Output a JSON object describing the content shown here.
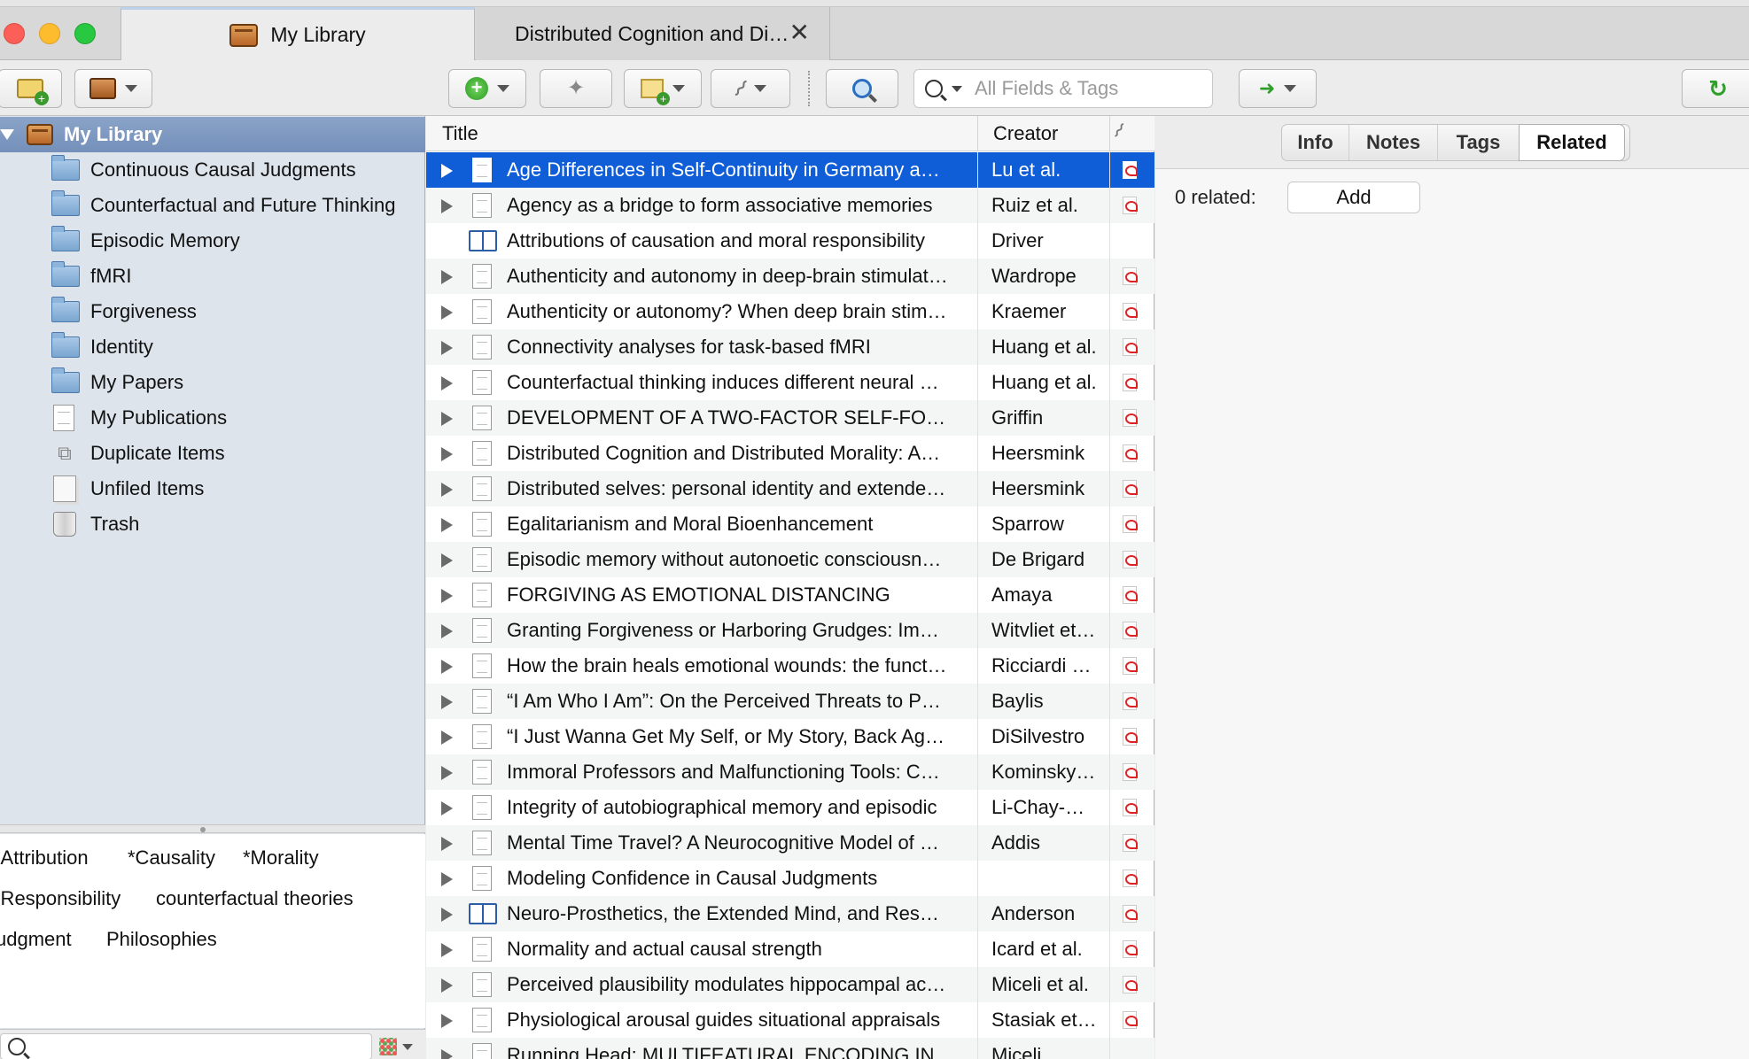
{
  "tabs": {
    "library": "My Library",
    "document": "Distributed Cognition and Distributed Morality"
  },
  "search": {
    "placeholder": "All Fields & Tags"
  },
  "sidebar": {
    "library": "My Library",
    "items": [
      {
        "label": "Continuous Causal Judgments",
        "icon": "folder-icon"
      },
      {
        "label": "Counterfactual and Future Thinking",
        "icon": "folder-icon"
      },
      {
        "label": "Episodic Memory",
        "icon": "folder-icon"
      },
      {
        "label": "fMRI",
        "icon": "folder-icon"
      },
      {
        "label": "Forgiveness",
        "icon": "folder-icon"
      },
      {
        "label": "Identity",
        "icon": "folder-icon"
      },
      {
        "label": "My Papers",
        "icon": "folder-icon"
      },
      {
        "label": "My Publications",
        "icon": "page-icon"
      },
      {
        "label": "Duplicate Items",
        "icon": "duplicate-icon"
      },
      {
        "label": "Unfiled Items",
        "icon": "unfiled-icon"
      },
      {
        "label": "Trash",
        "icon": "trash-icon"
      }
    ]
  },
  "tags": [
    "*Attribution",
    "*Causality",
    "*Morality",
    "*Responsibility",
    "counterfactual theories",
    "Judgment",
    "Philosophies"
  ],
  "columns": {
    "title": "Title",
    "creator": "Creator"
  },
  "items": [
    {
      "title": "Age Differences in Self-Continuity in Germany and China",
      "creator": "Lu et al.",
      "type": "article",
      "children": true,
      "pdf": true,
      "selected": true
    },
    {
      "title": "Agency as a bridge to form associative memories",
      "creator": "Ruiz et al.",
      "type": "article",
      "children": true,
      "pdf": true
    },
    {
      "title": "Attributions of causation and moral responsibility",
      "creator": "Driver",
      "type": "book",
      "children": false,
      "pdf": false
    },
    {
      "title": "Authenticity and autonomy in deep-brain stimulation",
      "creator": "Wardrope",
      "type": "article",
      "children": true,
      "pdf": true
    },
    {
      "title": "Authenticity or autonomy? When deep brain stimulation",
      "creator": "Kraemer",
      "type": "article",
      "children": true,
      "pdf": true
    },
    {
      "title": "Connectivity analyses for task-based fMRI",
      "creator": "Huang et al.",
      "type": "article",
      "children": true,
      "pdf": true
    },
    {
      "title": "Counterfactual thinking induces different neural patterns",
      "creator": "Huang et al.",
      "type": "article",
      "children": true,
      "pdf": true
    },
    {
      "title": "DEVELOPMENT OF A TWO-FACTOR SELF-FORGIVENESS",
      "creator": "Griffin",
      "type": "article",
      "children": true,
      "pdf": true
    },
    {
      "title": "Distributed Cognition and Distributed Morality: Agency",
      "creator": "Heersmink",
      "type": "article",
      "children": true,
      "pdf": true
    },
    {
      "title": "Distributed selves: personal identity and extended memory",
      "creator": "Heersmink",
      "type": "article",
      "children": true,
      "pdf": true
    },
    {
      "title": "Egalitarianism and Moral Bioenhancement",
      "creator": "Sparrow",
      "type": "article",
      "children": true,
      "pdf": true
    },
    {
      "title": "Episodic memory without autonoetic consciousness",
      "creator": "De Brigard",
      "type": "article",
      "children": true,
      "pdf": true
    },
    {
      "title": "FORGIVING AS EMOTIONAL DISTANCING",
      "creator": "Amaya",
      "type": "article",
      "children": true,
      "pdf": true
    },
    {
      "title": "Granting Forgiveness or Harboring Grudges: Implications",
      "creator": "Witvliet et al.",
      "type": "article",
      "children": true,
      "pdf": true
    },
    {
      "title": "How the brain heals emotional wounds: the functional",
      "creator": "Ricciardi et al.",
      "type": "article",
      "children": true,
      "pdf": true
    },
    {
      "title": "“I Am Who I Am”: On the Perceived Threats to Personal Identity",
      "creator": "Baylis",
      "type": "article",
      "children": true,
      "pdf": true
    },
    {
      "title": "“I Just Wanna Get My Self, or My Story, Back Again",
      "creator": "DiSilvestro",
      "type": "article",
      "children": true,
      "pdf": true
    },
    {
      "title": "Immoral Professors and Malfunctioning Tools: Counterfactual",
      "creator": "Kominsky et al.",
      "type": "article",
      "children": true,
      "pdf": true
    },
    {
      "title": "Integrity of autobiographical memory and episodic",
      "creator": "Li-Chay-Chung",
      "type": "article",
      "children": true,
      "pdf": true
    },
    {
      "title": "Mental Time Travel? A Neurocognitive Model of Event",
      "creator": "Addis",
      "type": "article",
      "children": true,
      "pdf": true
    },
    {
      "title": "Modeling Confidence in Causal Judgments",
      "creator": "",
      "type": "article",
      "children": true,
      "pdf": true
    },
    {
      "title": "Neuro-Prosthetics, the Extended Mind, and Respect",
      "creator": "Anderson",
      "type": "book",
      "children": true,
      "pdf": true
    },
    {
      "title": "Normality and actual causal strength",
      "creator": "Icard et al.",
      "type": "article",
      "children": true,
      "pdf": true
    },
    {
      "title": "Perceived plausibility modulates hippocampal activity",
      "creator": "Miceli et al.",
      "type": "article",
      "children": true,
      "pdf": true
    },
    {
      "title": "Physiological arousal guides situational appraisals",
      "creator": "Stasiak et al.",
      "type": "article",
      "children": true,
      "pdf": true
    },
    {
      "title": "Running Head: MULTIFEATURAL ENCODING IN",
      "creator": "Miceli",
      "type": "article",
      "children": true,
      "pdf": false
    }
  ],
  "right_pane": {
    "tabs": [
      "Info",
      "Notes",
      "Tags",
      "Related"
    ],
    "active_tab": "Related",
    "related_count": "0 related:",
    "add_label": "Add"
  },
  "colors": {
    "selection": "#0f5ed7",
    "sidebar_selected": "#7a95bf",
    "sidebar_bg": "#dde4ec"
  }
}
